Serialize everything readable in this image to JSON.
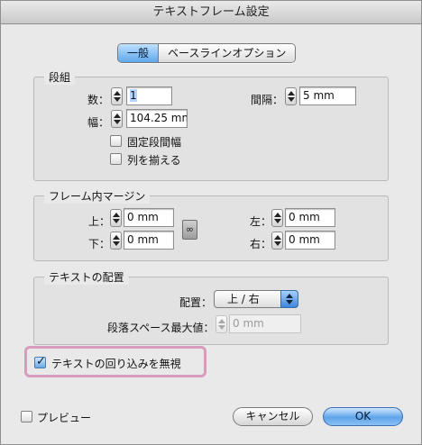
{
  "window": {
    "title": "テキストフレーム設定"
  },
  "tabs": [
    {
      "label": "一般",
      "active": true
    },
    {
      "label": "ベースラインオプション",
      "active": false
    }
  ],
  "columns": {
    "legend": "段組",
    "number_label": "数：",
    "number_value": "1",
    "width_label": "幅：",
    "width_value": "104.25 mm",
    "gutter_label": "間隔：",
    "gutter_value": "5 mm",
    "fixed_width_label": "固定段間幅",
    "fixed_width_checked": false,
    "balance_label": "列を揃える",
    "balance_checked": false
  },
  "inset": {
    "legend": "フレーム内マージン",
    "top_label": "上：",
    "top_value": "0 mm",
    "bottom_label": "下：",
    "bottom_value": "0 mm",
    "left_label": "左：",
    "left_value": "0 mm",
    "right_label": "右：",
    "right_value": "0 mm"
  },
  "vertical": {
    "legend": "テキストの配置",
    "align_label": "配置：",
    "align_value": "上 / 右",
    "max_space_label": "段落スペース最大値：",
    "max_space_value": "0 mm"
  },
  "ignore_wrap": {
    "label": "テキストの回り込みを無視",
    "checked": true
  },
  "preview": {
    "label": "プレビュー",
    "checked": false
  },
  "buttons": {
    "cancel": "キャンセル",
    "ok": "OK"
  },
  "colors": {
    "highlight": "#d79bbd",
    "accent": "#5ea4ea"
  }
}
